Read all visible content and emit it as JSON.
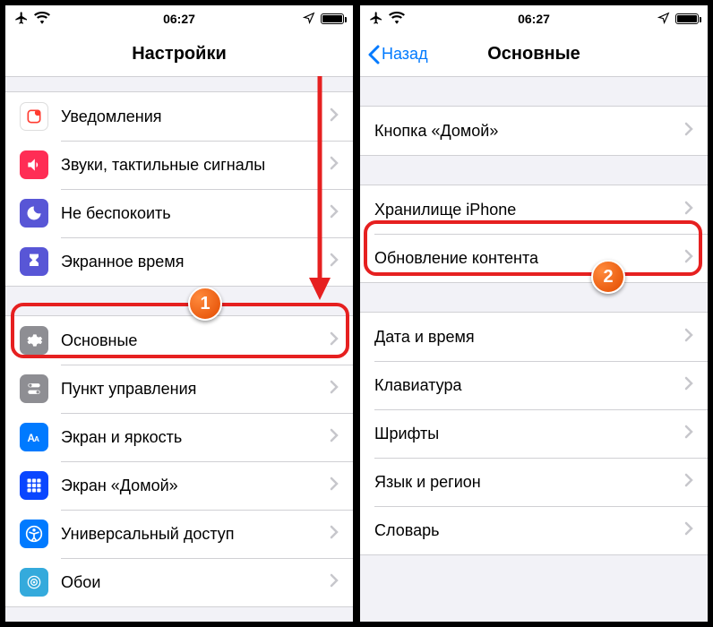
{
  "statusbar": {
    "time": "06:27"
  },
  "left": {
    "title": "Настройки",
    "group1": [
      {
        "label": "Уведомления"
      },
      {
        "label": "Звуки, тактильные сигналы"
      },
      {
        "label": "Не беспокоить"
      },
      {
        "label": "Экранное время"
      }
    ],
    "group2": [
      {
        "label": "Основные"
      },
      {
        "label": "Пункт управления"
      },
      {
        "label": "Экран и яркость"
      },
      {
        "label": "Экран «Домой»"
      },
      {
        "label": "Универсальный доступ"
      },
      {
        "label": "Обои"
      }
    ]
  },
  "right": {
    "back": "Назад",
    "title": "Основные",
    "group1": [
      {
        "label": "Кнопка «Домой»"
      }
    ],
    "group2": [
      {
        "label": "Хранилище iPhone"
      },
      {
        "label": "Обновление контента"
      }
    ],
    "group3": [
      {
        "label": "Дата и время"
      },
      {
        "label": "Клавиатура"
      },
      {
        "label": "Шрифты"
      },
      {
        "label": "Язык и регион"
      },
      {
        "label": "Словарь"
      }
    ]
  },
  "badges": {
    "one": "1",
    "two": "2"
  }
}
